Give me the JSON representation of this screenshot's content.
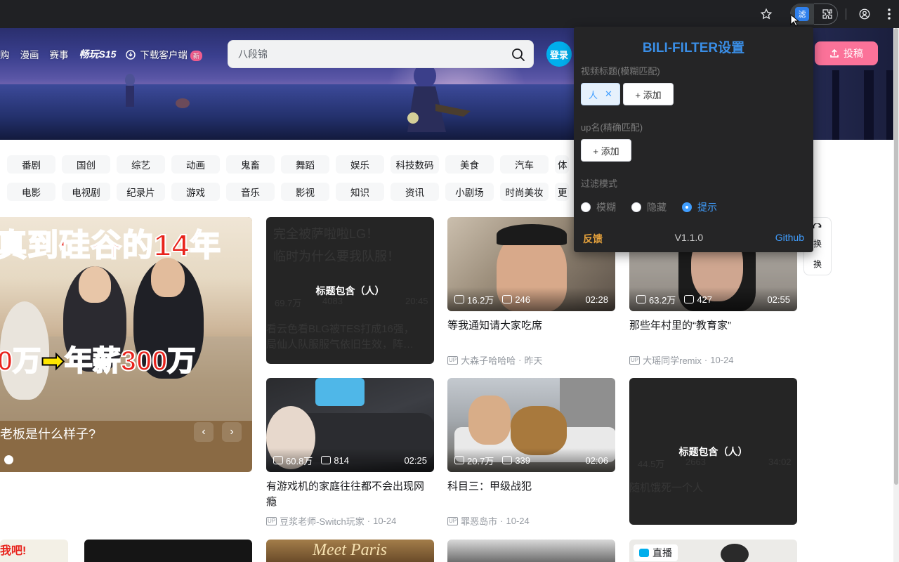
{
  "browser": {
    "icons": [
      "star-icon",
      "extension-bili-filter-icon",
      "puzzle-icon",
      "profile-icon",
      "more-icon"
    ]
  },
  "header": {
    "nav": [
      "购",
      "漫画",
      "赛事",
      "畅玩S15"
    ],
    "download_label": "下载客户端",
    "new_badge": "新",
    "search_placeholder": "八段锦",
    "login_label": "登录",
    "upload_label": "投稿"
  },
  "categories": {
    "row1": [
      "番剧",
      "国创",
      "综艺",
      "动画",
      "鬼畜",
      "舞蹈",
      "娱乐",
      "科技数码",
      "美食",
      "汽车",
      "体"
    ],
    "row2": [
      "电影",
      "电视剧",
      "纪录片",
      "游戏",
      "音乐",
      "影视",
      "知识",
      "资讯",
      "小剧场",
      "时尚美妆",
      "更"
    ]
  },
  "hero": {
    "title_line1": "真到硅谷的14年",
    "title_line2_left": "0万",
    "title_arrow": "➡",
    "title_line2_right": "年薪300万",
    "caption": "老板是什么样子?",
    "prev": "‹",
    "next": "›"
  },
  "cards": [
    {
      "blocked": true,
      "label": "标题包含（人）",
      "ghost_title": "看云色看BLG被TES打成16强，",
      "ghost_title2": "局仙人队服服气依旧生效，阵…",
      "ghost_views": "69.7万",
      "ghost_danmaku": "4083",
      "ghost_duration": "20:45"
    },
    {
      "views": "16.2万",
      "danmaku": "246",
      "duration": "02:28",
      "title": "等我通知请大家吃席",
      "up": "大森子哈哈哈",
      "date": "昨天"
    },
    {
      "views": "63.2万",
      "danmaku": "427",
      "duration": "02:55",
      "title": "那些年村里的“教育家”",
      "up": "大瑶同学remix",
      "date": "10-24"
    },
    {
      "views": "60.8万",
      "danmaku": "814",
      "duration": "02:25",
      "title": "有游戏机的家庭往往都不会出现网瘾",
      "up": "豆浆老师-Switch玩家",
      "date": "10-24"
    },
    {
      "views": "20.7万",
      "danmaku": "339",
      "duration": "02:06",
      "title": "科目三：甲级战犯",
      "up": "罪恶岛市",
      "date": "10-24"
    },
    {
      "blocked": true,
      "label": "标题包含（人）",
      "ghost_title": "随机饿死一个人",
      "ghost_views": "44.5万",
      "ghost_danmaku": "2663",
      "ghost_duration": "34:02"
    }
  ],
  "refresh": {
    "line1": "换",
    "line2": "换"
  },
  "live_badge": "直播",
  "popup": {
    "title": "BILI-FILTER设置",
    "label_title": "视频标题(模糊匹配)",
    "keyword": "人",
    "add_label": "+ 添加",
    "label_up": "up名(精确匹配)",
    "label_mode": "过滤模式",
    "modes": [
      "模糊",
      "隐藏",
      "提示"
    ],
    "selected_mode": "提示",
    "feedback": "反馈",
    "version": "V1.1.0",
    "github": "Github"
  },
  "colors": {
    "accent_blue": "#409eff",
    "bili_pink": "#fb7299",
    "bili_blue": "#00aeec",
    "popup_bg": "#252526"
  }
}
